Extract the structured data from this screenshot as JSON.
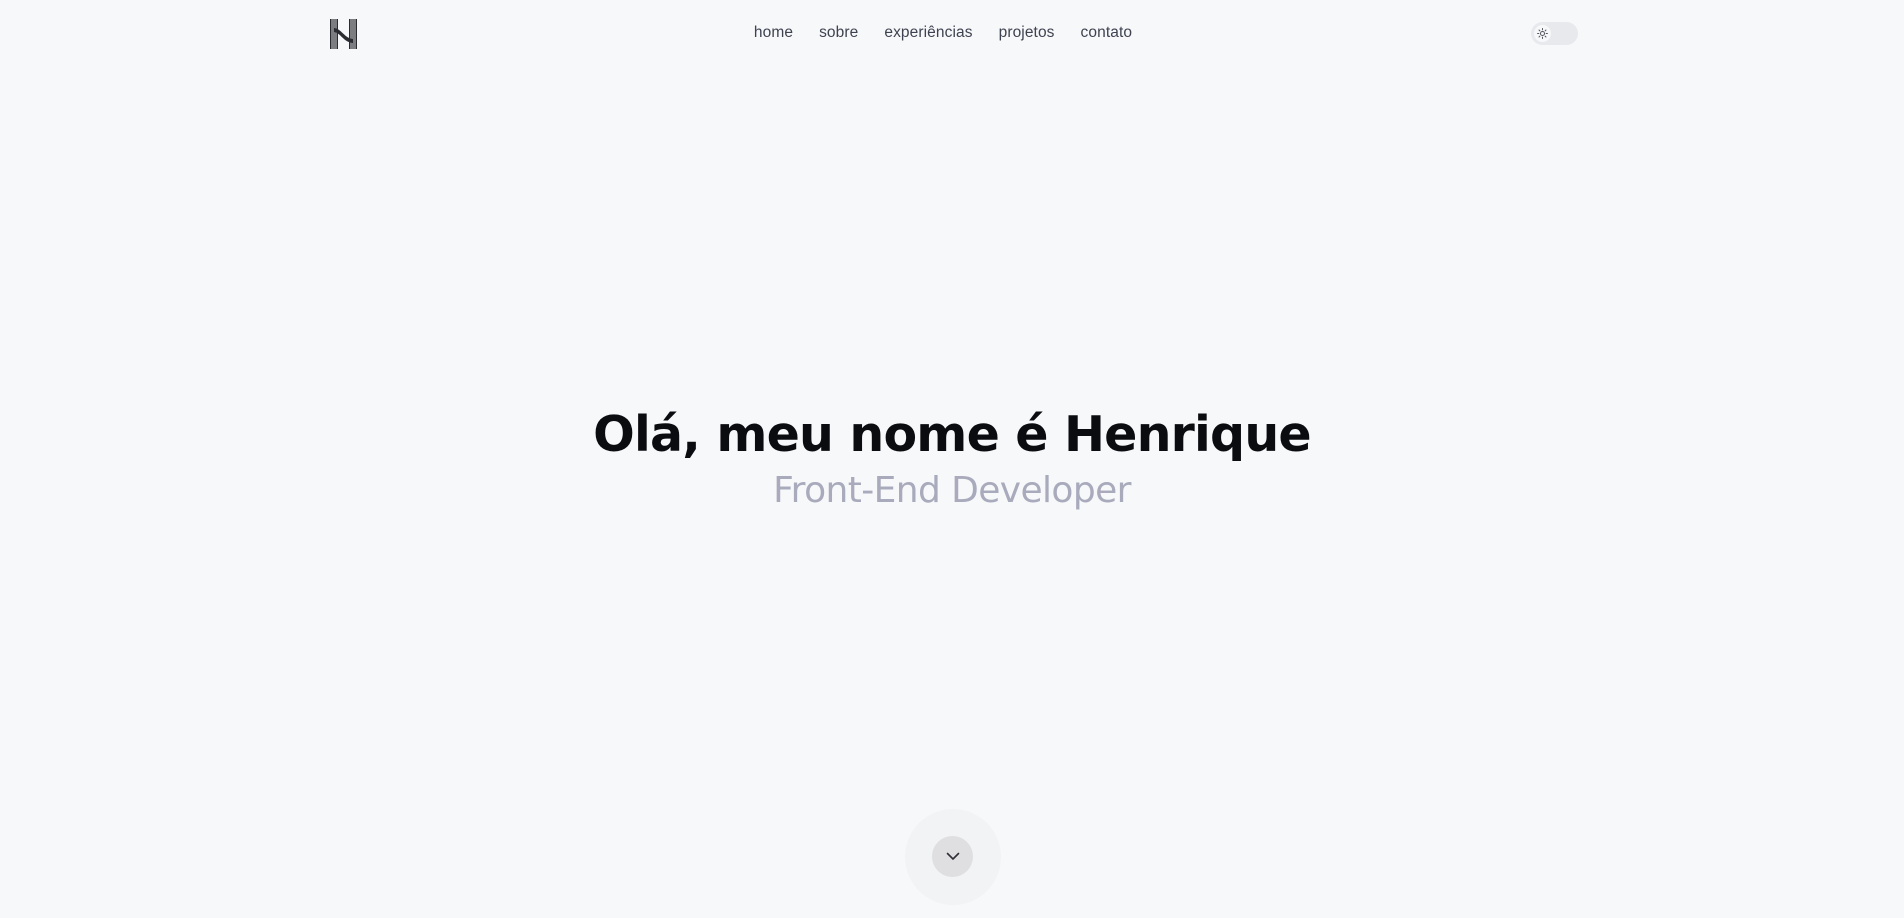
{
  "header": {
    "logo_icon": "h-monogram-logo-icon",
    "nav": [
      {
        "label": "home"
      },
      {
        "label": "sobre"
      },
      {
        "label": "experiências"
      },
      {
        "label": "projetos"
      },
      {
        "label": "contato"
      }
    ],
    "theme_toggle": {
      "icon": "sun-icon",
      "state": "light"
    }
  },
  "hero": {
    "title": "Olá, meu nome é Henrique",
    "subtitle": "Front-End Developer"
  },
  "scroll_down": {
    "icon": "chevron-down-icon"
  },
  "colors": {
    "background": "#f7f8fa",
    "title": "#0b0c10",
    "subtitle": "#a9abbd",
    "nav_text": "#3f4350",
    "toggle_track": "#e8e9ec",
    "scroll_button": "#dfdfe1"
  }
}
